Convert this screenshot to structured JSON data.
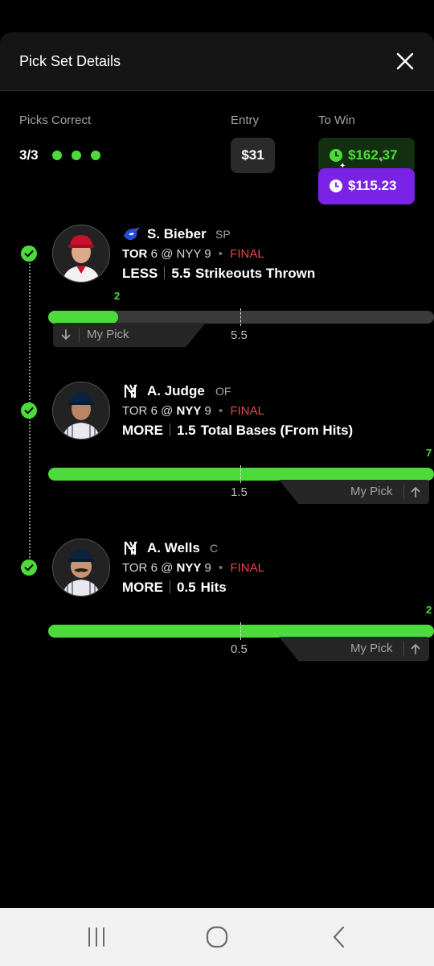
{
  "header": {
    "title": "Pick Set Details",
    "close_icon": "close-icon"
  },
  "summary": {
    "picks_correct_label": "Picks Correct",
    "picks_correct_value": "3/3",
    "entry_label": "Entry",
    "entry_value": "$31",
    "to_win_label": "To Win",
    "to_win_green": "$162.37",
    "to_win_purple": "$115.23"
  },
  "picks": [
    {
      "player": "S. Bieber",
      "position": "SP",
      "team_logo": "blue-jays-logo",
      "away": "TOR",
      "away_score": "6",
      "at": "@",
      "home": "NYY",
      "home_score": "9",
      "status": "FINAL",
      "direction": "LESS",
      "line": "5.5",
      "stat": "Strikeouts Thrown",
      "actual": "2",
      "actual_value": 2,
      "bar_max": 11,
      "my_pick_label": "My Pick",
      "pick_icon": "arrow-down-icon"
    },
    {
      "player": "A. Judge",
      "position": "OF",
      "team_logo": "yankees-logo",
      "away": "TOR",
      "away_score": "6",
      "at": "@",
      "home": "NYY",
      "home_score": "9",
      "status": "FINAL",
      "direction": "MORE",
      "line": "1.5",
      "stat": "Total Bases (From Hits)",
      "actual": "7",
      "actual_value": 7,
      "bar_max": 3,
      "my_pick_label": "My Pick",
      "pick_icon": "arrow-up-icon"
    },
    {
      "player": "A. Wells",
      "position": "C",
      "team_logo": "yankees-logo",
      "away": "TOR",
      "away_score": "6",
      "at": "@",
      "home": "NYY",
      "home_score": "9",
      "status": "FINAL",
      "direction": "MORE",
      "line": "0.5",
      "stat": "Hits",
      "actual": "2",
      "actual_value": 2,
      "bar_max": 1,
      "my_pick_label": "My Pick",
      "pick_icon": "arrow-up-icon"
    }
  ],
  "colors": {
    "accent_green": "#4ddb3c",
    "accent_purple": "#7a22e6",
    "final_red": "#e5484d"
  },
  "navbar": {
    "recents_icon": "recent-apps-icon",
    "home_icon": "home-icon",
    "back_icon": "back-icon"
  }
}
